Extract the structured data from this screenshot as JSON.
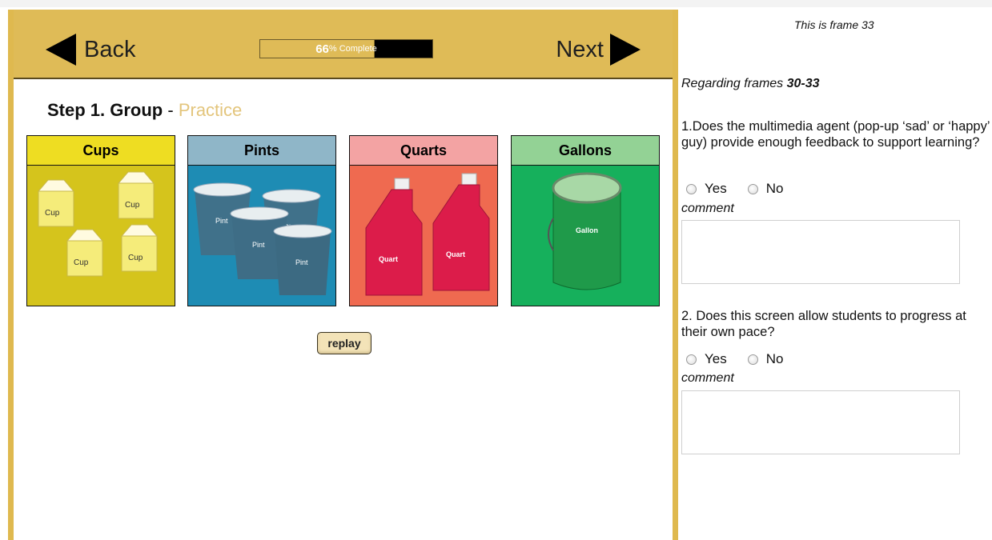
{
  "lesson": {
    "nav": {
      "back_label": "Back",
      "next_label": "Next"
    },
    "progress": {
      "value": 0.66,
      "percent_text": "66",
      "suffix_text": "% Complete"
    },
    "step": {
      "title": "Step 1. Group",
      "separator": " - ",
      "subtitle": "Practice"
    },
    "cards": [
      {
        "label": "Cups",
        "item_text": "Cup",
        "header_color": "#eedd22",
        "body_color": "#d5c41c"
      },
      {
        "label": "Pints",
        "item_text": "Pint",
        "header_color": "#8fb6c8",
        "body_color": "#1e8cb4"
      },
      {
        "label": "Quarts",
        "item_text": "Quart",
        "header_color": "#f3a3a3",
        "body_color": "#ef6a50"
      },
      {
        "label": "Gallons",
        "item_text": "Gallon",
        "header_color": "#93d295",
        "body_color": "#16b05c"
      }
    ],
    "replay_label": "replay"
  },
  "survey": {
    "frame_text": "This is frame 33",
    "regarding_prefix": "Regarding frames ",
    "regarding_range": "30-33",
    "questions": [
      {
        "text": "1.Does the multimedia agent (pop-up ‘sad’ or ‘happy’ guy) provide enough feedback to support learning?",
        "yes": "Yes",
        "no": "No",
        "comment_label": "comment"
      },
      {
        "text": "2. Does this screen allow students to progress at their own pace?",
        "yes": "Yes",
        "no": "No",
        "comment_label": "comment"
      }
    ]
  }
}
